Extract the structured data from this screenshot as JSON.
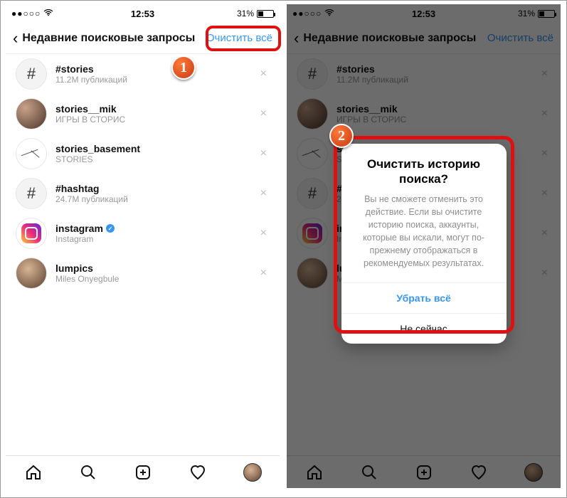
{
  "status": {
    "signal": "●●○○○",
    "wifi": true,
    "time": "12:53",
    "battery_pct": "31%"
  },
  "nav": {
    "title": "Недавние поисковые запросы",
    "clear_all": "Очистить всё"
  },
  "items": [
    {
      "name": "#stories",
      "sub": "11.2M публикаций",
      "kind": "hash"
    },
    {
      "name": "stories__mik",
      "sub": "ИГРЫ В СТОРИС",
      "kind": "photo1"
    },
    {
      "name": "stories_basement",
      "sub": "STORIES",
      "kind": "clock"
    },
    {
      "name": "#hashtag",
      "sub": "24.7M публикаций",
      "kind": "hash"
    },
    {
      "name": "instagram",
      "sub": "Instagram",
      "kind": "ig",
      "verified": true
    },
    {
      "name": "lumpics",
      "sub": "Miles Onyegbule",
      "kind": "photo3"
    }
  ],
  "badges": {
    "one": "1",
    "two": "2"
  },
  "modal": {
    "title": "Очистить историю поиска?",
    "body": "Вы не сможете отменить это действие. Если вы очистите историю поиска, аккаунты, которые вы искали, могут по-прежнему отображаться в рекомендуемых результатах.",
    "confirm": "Убрать всё",
    "cancel": "Не сейчас"
  }
}
